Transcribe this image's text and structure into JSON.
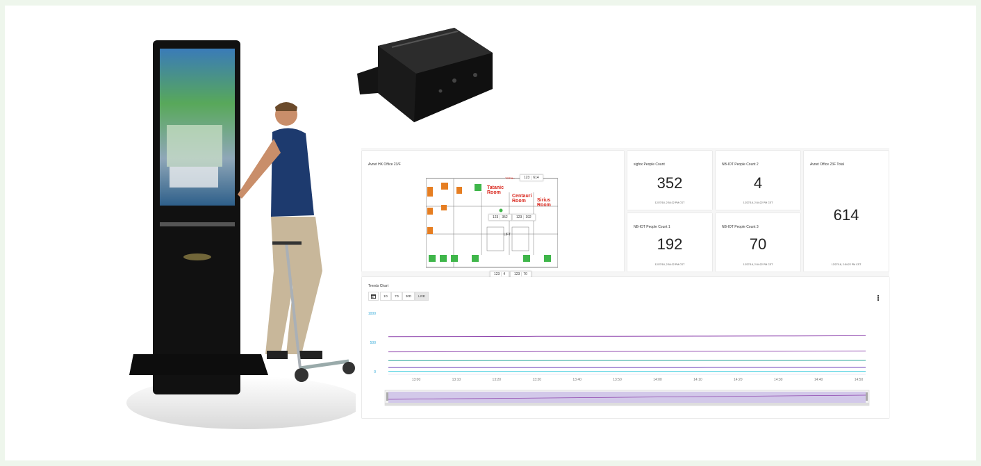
{
  "floor_card": {
    "title": "Avnet HK Office 23/F",
    "total_label": "TOTAL:",
    "total_chip": [
      "123",
      "614"
    ],
    "mid_chips": [
      [
        "123",
        "352"
      ],
      [
        "123",
        "192"
      ]
    ],
    "bottom_chips": [
      [
        "123",
        "4"
      ],
      [
        "123",
        "70"
      ]
    ],
    "rooms": [
      "Tatanic Room",
      "Centauri Room",
      "Sirius Room"
    ],
    "lift_label": "LIFT"
  },
  "tiles": [
    {
      "title": "sigfox People Count",
      "value": "352",
      "timestamp": "12/27/18, 2:54:22 PM CST"
    },
    {
      "title": "NB-IOT People Count 2",
      "value": "4",
      "timestamp": "12/27/18, 2:54:22 PM CST"
    },
    {
      "title": "NB-IOT People Count 1",
      "value": "192",
      "timestamp": "12/27/18, 2:54:22 PM CST"
    },
    {
      "title": "NB-IOT People Count 3",
      "value": "70",
      "timestamp": "12/27/18, 2:54:22 PM CST"
    }
  ],
  "total_tile": {
    "title": "Avnet Office 23F Total",
    "value": "614",
    "timestamp": "12/27/18, 2:54:22 PM CST"
  },
  "trends": {
    "title": "Trends Chart",
    "calendar_icon": "calendar-icon",
    "ranges": [
      "1D",
      "7D",
      "30D",
      "LIVE"
    ],
    "active_range": "LIVE",
    "menu_icon": "more-vert-icon"
  },
  "chart_data": {
    "type": "line",
    "x": [
      "13:00",
      "13:10",
      "13:20",
      "13:30",
      "13:40",
      "13:50",
      "14:00",
      "14:10",
      "14:20",
      "14:30",
      "14:40",
      "14:50"
    ],
    "ylim": [
      0,
      1000
    ],
    "yticks": [
      0,
      500,
      1000
    ],
    "series": [
      {
        "color": "#8e44ad",
        "values": [
          598,
          600,
          601,
          603,
          604,
          605,
          606,
          607,
          608,
          609,
          612,
          614
        ]
      },
      {
        "color": "#9b59b6",
        "values": [
          338,
          340,
          341,
          342,
          343,
          344,
          345,
          347,
          348,
          349,
          351,
          352
        ]
      },
      {
        "color": "#26a69a",
        "values": [
          188,
          188,
          189,
          189,
          190,
          190,
          190,
          191,
          191,
          191,
          192,
          192
        ]
      },
      {
        "color": "#7e57c2",
        "values": [
          68,
          68,
          68,
          69,
          69,
          69,
          69,
          69,
          70,
          70,
          70,
          70
        ]
      },
      {
        "color": "#26c6da",
        "values": [
          4,
          4,
          4,
          4,
          4,
          4,
          4,
          4,
          4,
          4,
          4,
          4
        ]
      }
    ],
    "grid": false
  },
  "colors": {
    "accent": "#31a9d8",
    "room_label": "#d9261c",
    "green_room": "#3fb64a",
    "orange_room": "#e67e22"
  }
}
